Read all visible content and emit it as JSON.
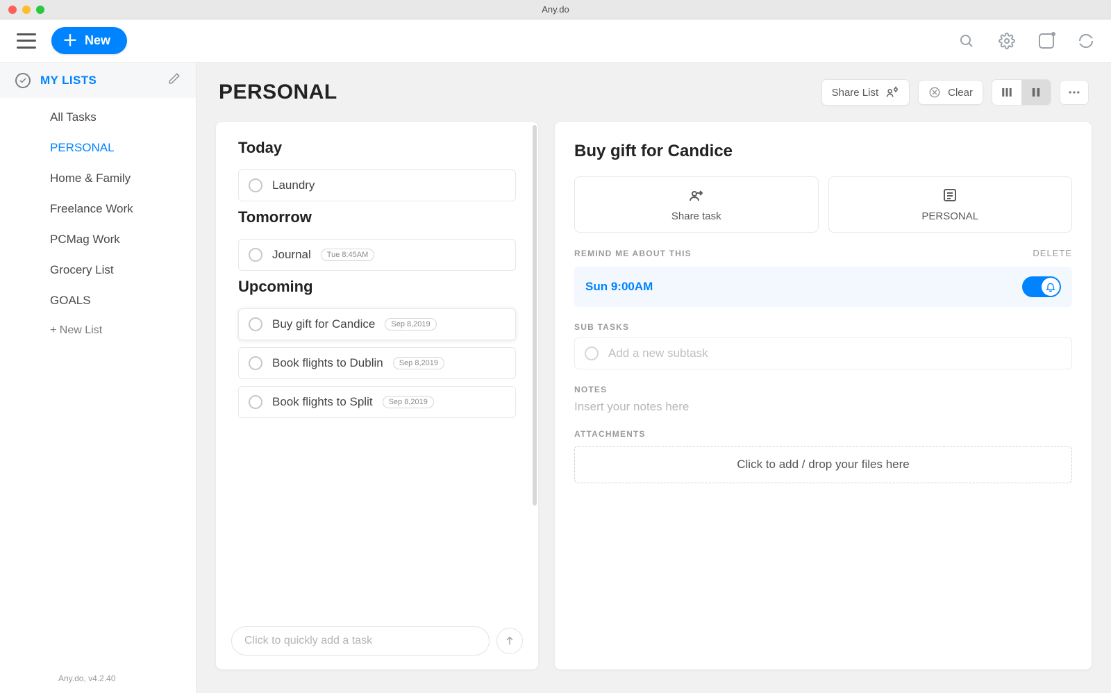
{
  "window": {
    "title": "Any.do"
  },
  "toolbar": {
    "new_label": "New"
  },
  "sidebar": {
    "header": "MY LISTS",
    "items": [
      {
        "label": "All Tasks"
      },
      {
        "label": "PERSONAL",
        "active": true
      },
      {
        "label": "Home & Family"
      },
      {
        "label": "Freelance Work"
      },
      {
        "label": "PCMag Work"
      },
      {
        "label": "Grocery List"
      },
      {
        "label": "GOALS"
      }
    ],
    "add_label": "+ New List",
    "footer": "Any.do, v4.2.40"
  },
  "main": {
    "title": "PERSONAL",
    "actions": {
      "share": "Share List",
      "clear": "Clear"
    },
    "sections": [
      {
        "title": "Today",
        "tasks": [
          {
            "text": "Laundry"
          }
        ]
      },
      {
        "title": "Tomorrow",
        "tasks": [
          {
            "text": "Journal",
            "tag": "Tue 8:45AM"
          }
        ]
      },
      {
        "title": "Upcoming",
        "tasks": [
          {
            "text": "Buy gift for Candice",
            "tag": "Sep 8,2019",
            "selected": true
          },
          {
            "text": "Book flights to Dublin",
            "tag": "Sep 8,2019"
          },
          {
            "text": "Book flights to Split",
            "tag": "Sep 8,2019"
          }
        ]
      }
    ],
    "quick_add_placeholder": "Click to quickly add a task"
  },
  "detail": {
    "title": "Buy gift for Candice",
    "share_card": "Share task",
    "list_card": "PERSONAL",
    "remind_label": "REMIND ME ABOUT THIS",
    "delete_label": "DELETE",
    "remind_time": "Sun 9:00AM",
    "subtasks_label": "SUB TASKS",
    "subtask_placeholder": "Add a new subtask",
    "notes_label": "NOTES",
    "notes_placeholder": "Insert your notes here",
    "attach_label": "ATTACHMENTS",
    "attach_cta": "Click to add / drop your files here"
  }
}
